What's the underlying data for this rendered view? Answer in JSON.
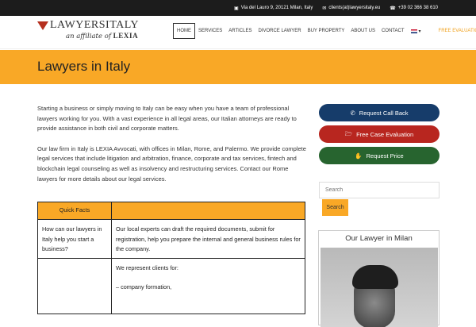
{
  "topbar": {
    "address": "Via del Lauro 9, 20121 Milan, Italy",
    "email": "clients(at)lawyersitaly.eu",
    "phone": "+39 02 366 38 610"
  },
  "logo": {
    "brand": "LAWYERSITALY",
    "affiliate": "an affiliate of",
    "affiliate_name": "LEXIA"
  },
  "nav": {
    "items": [
      "HOME",
      "SERVICES",
      "ARTICLES",
      "DIVORCE LAWYER",
      "BUY PROPERTY",
      "ABOUT US",
      "CONTACT"
    ],
    "lang_caret": "▾",
    "cta": "FREE EVALUATION"
  },
  "page_title": "Lawyers in Italy",
  "intro": [
    "Starting a business or simply moving to Italy can be easy when you have a team of professional lawyers working for you. With a vast experience in all legal areas, our Italian attorneys are ready to provide assistance in both civil and corporate matters.",
    "Our law firm in Italy is LEXIA Avvocati, with offices in Milan, Rome, and Palermo. We provide complete legal services that include litigation and arbitration, finance, corporate and tax services, fintech and blockchain legal counseling as well as insolvency and restructuring services. Contact our Rome lawyers for more details about our legal services."
  ],
  "facts": {
    "header": "Quick Facts",
    "rows": [
      {
        "q": "How can our lawyers in Italy help you start a business?",
        "a": "Our local experts can draft the required documents, submit for registration, help you prepare the internal and general business rules for the company."
      },
      {
        "q": "",
        "a1": "We represent clients for:",
        "a2": "– company formation,"
      }
    ]
  },
  "sidebar": {
    "buttons": [
      "Request Call Back",
      "Free Case Evaluation",
      "Request Price"
    ],
    "search_placeholder": "Search",
    "search_button": "Search",
    "lawyer_title": "Our Lawyer in Milan"
  },
  "colors": {
    "accent": "#f9a826",
    "btn_blue": "#163c6a",
    "btn_red": "#b8261f",
    "btn_green": "#27642f"
  }
}
